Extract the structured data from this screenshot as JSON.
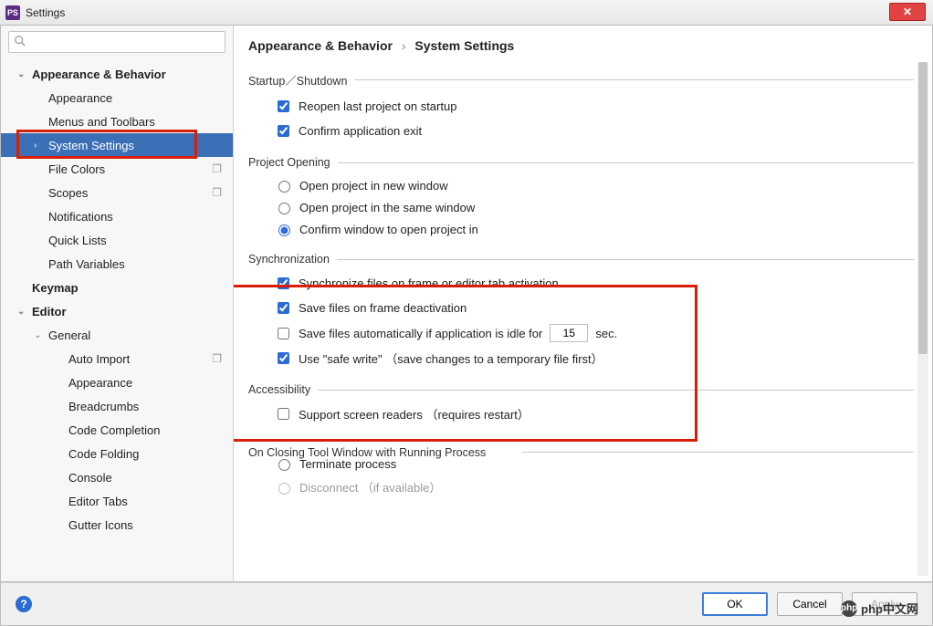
{
  "title": "Settings",
  "app_icon_text": "PS",
  "search_placeholder": "",
  "breadcrumb": {
    "a": "Appearance & Behavior",
    "sep": "›",
    "b": "System Settings"
  },
  "tree": {
    "appearance_behavior": "Appearance & Behavior",
    "appearance": "Appearance",
    "menus_toolbars": "Menus  and  Toolbars",
    "system_settings": "System  Settings",
    "file_colors": "File  Colors",
    "scopes": "Scopes",
    "notifications": "Notifications",
    "quick_lists": "Quick  Lists",
    "path_variables": "Path  Variables",
    "keymap": "Keymap",
    "editor": "Editor",
    "general": "General",
    "auto_import": "Auto  Import",
    "appearance2": "Appearance",
    "breadcrumbs": "Breadcrumbs",
    "code_completion": "Code  Completion",
    "code_folding": "Code  Folding",
    "console": "Console",
    "editor_tabs": "Editor  Tabs",
    "gutter_icons": "Gutter  Icons"
  },
  "sections": {
    "startup": {
      "legend": "Startup／Shutdown",
      "reopen": "Reopen  last  project  on  startup",
      "confirm_exit": "Confirm  application  exit"
    },
    "project_opening": {
      "legend": "Project  Opening",
      "new_window": "Open  project  in  new  window",
      "same_window": "Open  project  in  the  same  window",
      "confirm": "Confirm  window  to  open  project  in"
    },
    "sync": {
      "legend": "Synchronization",
      "sync_frame": "Synchronize  files  on  frame  or  editor  tab  activation",
      "save_deact": "Save  files  on  frame  deactivation",
      "save_idle_pre": "Save  files  automatically  if  application  is  idle  for",
      "idle_val": "15",
      "save_idle_post": "sec.",
      "safe_write": "Use  \"safe  write\" （save  changes  to  a  temporary  file  first）"
    },
    "accessibility": {
      "legend": "Accessibility",
      "screen_readers": "Support  screen  readers （requires  restart）"
    },
    "closing": {
      "legend": "On  Closing  Tool  Window  with  Running  Process",
      "terminate": "Terminate  process",
      "disconnect": "Disconnect （if  available）"
    }
  },
  "footer": {
    "ok": "OK",
    "cancel": "Cancel",
    "apply": "Apply"
  },
  "watermark": "php中文网"
}
